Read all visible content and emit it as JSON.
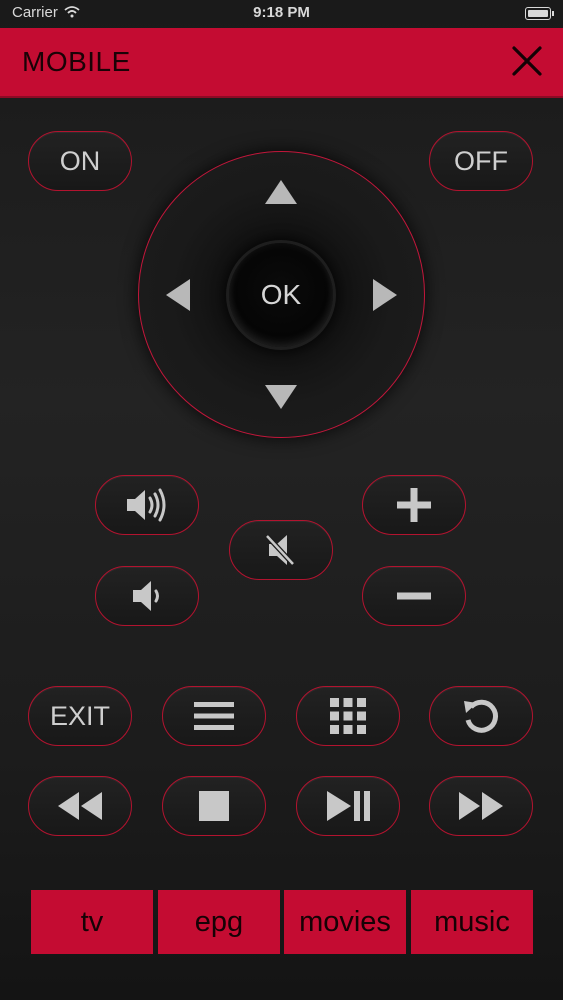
{
  "status_bar": {
    "carrier": "Carrier",
    "time": "9:18 PM"
  },
  "header": {
    "title": "MOBILE"
  },
  "power": {
    "on_label": "ON",
    "off_label": "OFF"
  },
  "dpad": {
    "ok_label": "OK"
  },
  "menu": {
    "exit_label": "EXIT"
  },
  "tabs": [
    {
      "label": "tv"
    },
    {
      "label": "epg"
    },
    {
      "label": "movies"
    },
    {
      "label": "music"
    }
  ],
  "colors": {
    "accent": "#c40c32",
    "border": "#b3132f",
    "icon": "#c8c8c8",
    "background": "#1e1e1e"
  }
}
